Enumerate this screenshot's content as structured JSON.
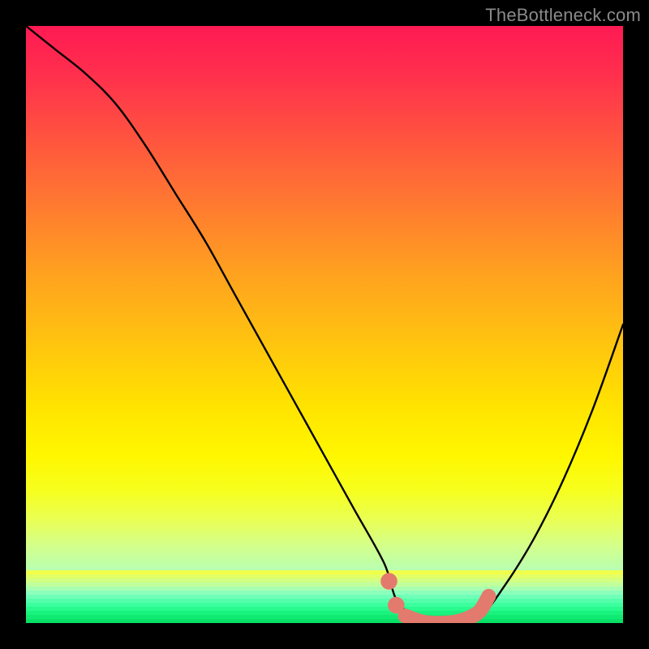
{
  "watermark": {
    "text": "TheBottleneck.com"
  },
  "colors": {
    "frame": "#000000",
    "curve": "#000000",
    "highlight": "#e37a6e",
    "grad_top": "#ff1a53",
    "grad_mid": "#ffe400",
    "grad_bot": "#10f07a"
  },
  "chart_data": {
    "type": "line",
    "title": "",
    "xlabel": "",
    "ylabel": "",
    "xlim": [
      0,
      100
    ],
    "ylim": [
      0,
      100
    ],
    "series": [
      {
        "name": "bottleneck-curve",
        "x": [
          0,
          5,
          10,
          15,
          20,
          25,
          30,
          35,
          40,
          45,
          50,
          55,
          60,
          62,
          65,
          68,
          72,
          76,
          80,
          85,
          90,
          95,
          100
        ],
        "y": [
          100,
          96,
          92,
          87,
          80,
          72,
          64,
          55,
          46,
          37,
          28,
          19,
          10,
          4,
          1,
          0,
          0,
          1,
          6,
          14,
          24,
          36,
          50
        ]
      }
    ],
    "highlight_segments": [
      {
        "name": "left-dot-upper",
        "cx": 60.8,
        "cy": 7.0,
        "r": 1.4,
        "shape": "circle"
      },
      {
        "name": "left-dot-lower",
        "cx": 62.0,
        "cy": 3.0,
        "r": 1.4,
        "shape": "circle"
      },
      {
        "name": "valley-stroke",
        "shape": "path",
        "x": [
          63.5,
          66,
          68,
          70,
          72,
          74,
          76,
          77.5
        ],
        "y": [
          1.2,
          0.3,
          0.0,
          0.0,
          0.2,
          0.8,
          2.0,
          4.5
        ]
      }
    ]
  }
}
